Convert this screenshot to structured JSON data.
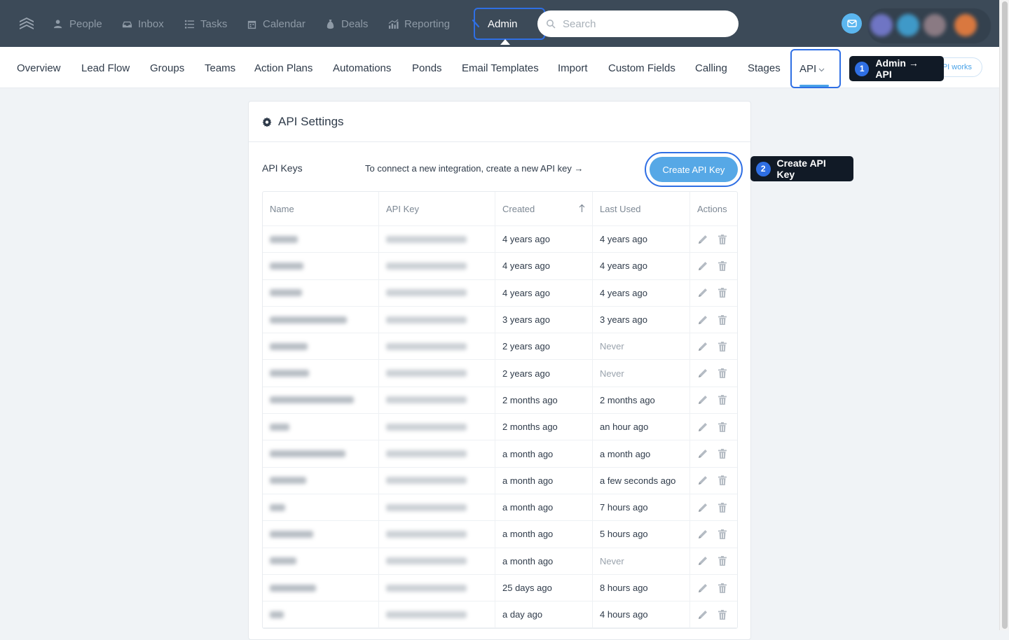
{
  "topnav": {
    "items": [
      {
        "label": "People",
        "icon": "person-icon"
      },
      {
        "label": "Inbox",
        "icon": "inbox-icon"
      },
      {
        "label": "Tasks",
        "icon": "list-icon"
      },
      {
        "label": "Calendar",
        "icon": "calendar-icon"
      },
      {
        "label": "Deals",
        "icon": "money-bag-icon"
      },
      {
        "label": "Reporting",
        "icon": "chart-icon"
      }
    ],
    "admin_label": "Admin",
    "search_placeholder": "Search"
  },
  "subnav": {
    "items": [
      "Overview",
      "Lead Flow",
      "Groups",
      "Teams",
      "Action Plans",
      "Automations",
      "Ponds",
      "Email Templates",
      "Import",
      "Custom Fields",
      "Calling",
      "Stages"
    ],
    "api_label": "API",
    "pill_text": "PI works"
  },
  "tooltips": {
    "step1": {
      "num": "1",
      "text": "Admin → API"
    },
    "step2": {
      "num": "2",
      "text": "Create API Key"
    }
  },
  "card": {
    "title": "API Settings",
    "keys_label": "API Keys",
    "hint": "To connect a new integration, create a new API key →",
    "create_button": "Create API Key"
  },
  "table": {
    "headers": [
      "Name",
      "API Key",
      "Created",
      "Last Used",
      "Actions"
    ],
    "rows": [
      {
        "created": "4 years ago",
        "last_used": "4 years ago"
      },
      {
        "created": "4 years ago",
        "last_used": "4 years ago"
      },
      {
        "created": "4 years ago",
        "last_used": "4 years ago"
      },
      {
        "created": "3 years ago",
        "last_used": "3 years ago"
      },
      {
        "created": "2 years ago",
        "last_used": "Never"
      },
      {
        "created": "2 years ago",
        "last_used": "Never"
      },
      {
        "created": "2 months ago",
        "last_used": "2 months ago"
      },
      {
        "created": "2 months ago",
        "last_used": "an hour ago"
      },
      {
        "created": "a month ago",
        "last_used": "a month ago"
      },
      {
        "created": "a month ago",
        "last_used": "a few seconds ago"
      },
      {
        "created": "a month ago",
        "last_used": "7 hours ago"
      },
      {
        "created": "a month ago",
        "last_used": "5 hours ago"
      },
      {
        "created": "a month ago",
        "last_used": "Never"
      },
      {
        "created": "25 days ago",
        "last_used": "8 hours ago"
      },
      {
        "created": "a day ago",
        "last_used": "4 hours ago"
      }
    ]
  },
  "colors": {
    "nav_bg": "#3c4a58",
    "accent": "#2f6fe4",
    "button": "#56a8e6"
  }
}
